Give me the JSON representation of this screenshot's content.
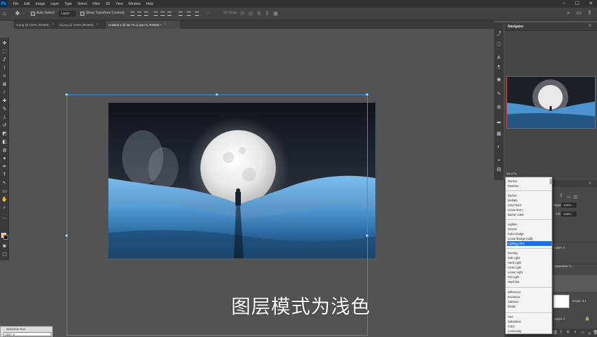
{
  "menubar": {
    "logo": "Ps",
    "items": [
      "File",
      "Edit",
      "Image",
      "Layer",
      "Type",
      "Select",
      "Filter",
      "3D",
      "View",
      "Window",
      "Help"
    ],
    "controls": [
      "–",
      "☐",
      "✕"
    ]
  },
  "options": {
    "auto_select_label": "Auto-Select:",
    "auto_select_target": "Layer",
    "show_transform_label": "Show Transform Controls",
    "mode_3d_label": "3D Mode:",
    "more_label": "···"
  },
  "tabs": [
    {
      "label": "5.png @ 100% (RGB/8)",
      "active": false
    },
    {
      "label": "13.png @ 100% (RGB/8)",
      "active": false
    },
    {
      "label": "Untitled-1 @ 66.7% (Layer 6, RGB/8) *",
      "active": true
    }
  ],
  "tab_close": "×",
  "subtitle": "图层模式为浅色",
  "selective_tool": {
    "title": "Selective Tool",
    "value": "Ctrl+ 2"
  },
  "navigator": {
    "title": "Navigator",
    "zoom": "66.67%"
  },
  "layers_panel": {
    "opacity_label": "Opacity:",
    "opacity_value": "100%",
    "fill_label": "Fill:",
    "fill_value": "100%",
    "layer_name": "Layer 4",
    "layer_name_2": "Saturation 2...",
    "layer_name_3": "Gradi...ll 1",
    "layer_name_4": "Layer 3"
  },
  "blend_modes": {
    "groups": [
      [
        "Normal",
        "Dissolve"
      ],
      [
        "Darken",
        "Multiply",
        "Color Burn",
        "Linear Burn",
        "Darker Color"
      ],
      [
        "Lighten",
        "Screen",
        "Color Dodge",
        "Linear Dodge (Add)",
        "Lighter Color"
      ],
      [
        "Overlay",
        "Soft Light",
        "Hard Light",
        "Vivid Light",
        "Linear Light",
        "Pin Light",
        "Hard Mix"
      ],
      [
        "Difference",
        "Exclusion",
        "Subtract",
        "Divide"
      ],
      [
        "Hue",
        "Saturation",
        "Color",
        "Luminosity"
      ]
    ],
    "selected": "Lighter Color"
  },
  "colors": {
    "foreground": "#f2d200",
    "background": "#1a1a1a",
    "transform_bound": "#3a8ee6",
    "dropdown_highlight": "#1e6fd9"
  }
}
